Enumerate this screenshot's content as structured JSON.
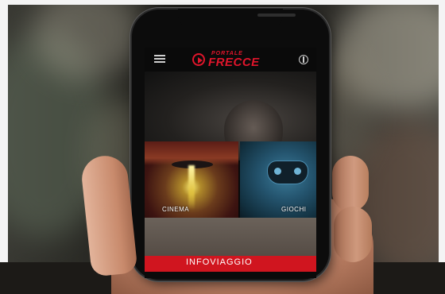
{
  "app": {
    "logo_small": "PORTALE",
    "logo_big": "FRECCE"
  },
  "tiles": [
    {
      "label": "CINEMA"
    },
    {
      "label": "GIOCHI"
    }
  ],
  "infobar": {
    "label": "INFOVIAGGIO"
  },
  "colors": {
    "brand_red": "#e0152b",
    "infobar_red": "#d0151f"
  }
}
